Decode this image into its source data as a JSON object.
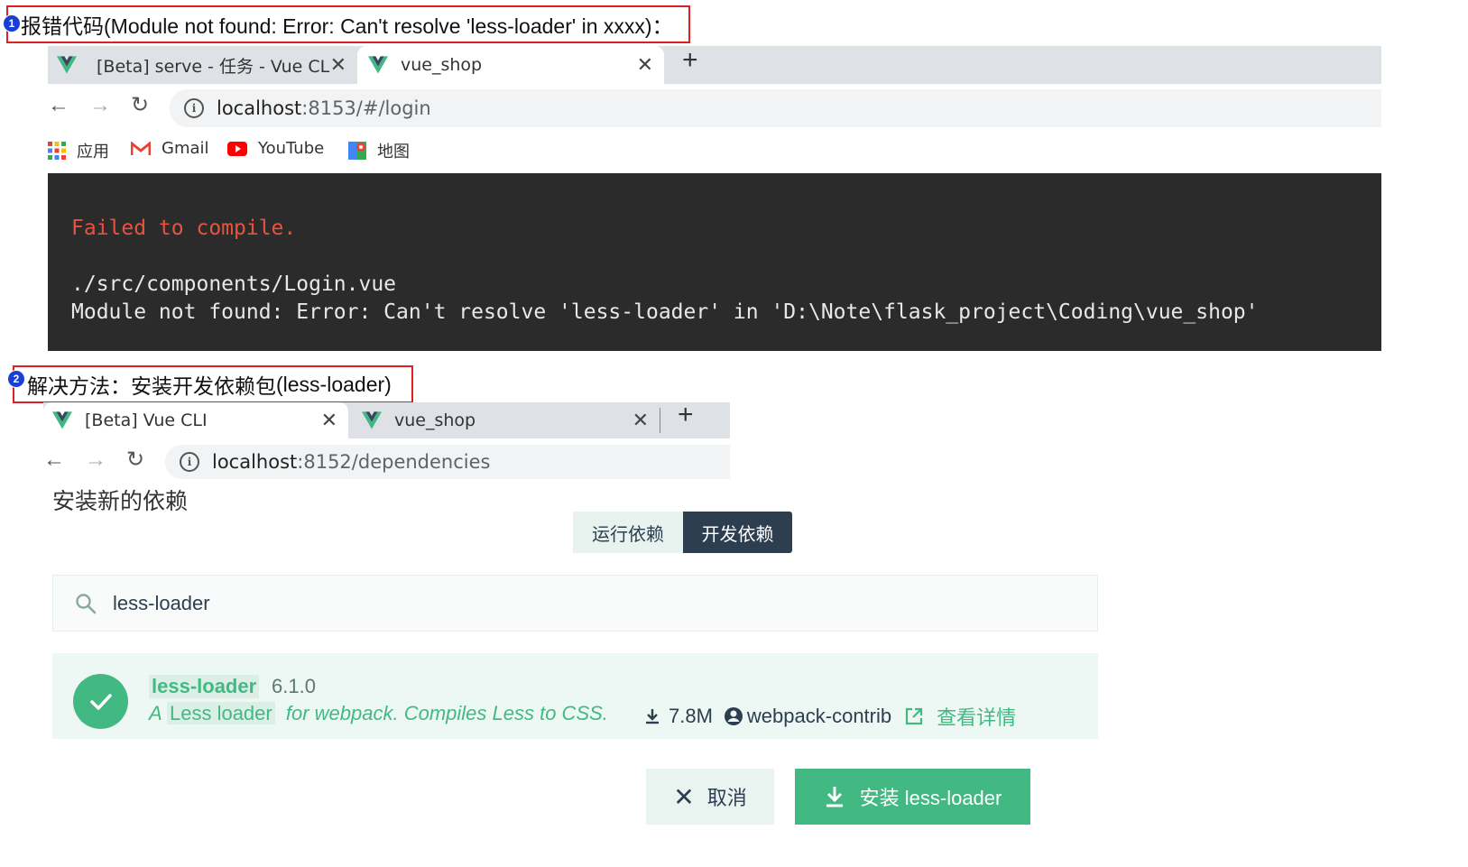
{
  "annotation1": {
    "number": "1",
    "label_cn": "报错代码",
    "label_en": "(Module not found: Error: Can't resolve 'less-loader' in xxxx)："
  },
  "annotation2": {
    "number": "2",
    "label_cn": "解决方法：安装开发依赖包",
    "label_en": "(less-loader)"
  },
  "browser1": {
    "tabs": [
      {
        "title": "[Beta] serve - 任务 - Vue CLI"
      },
      {
        "title": "vue_shop"
      }
    ],
    "new_tab": "+",
    "url_host": "localhost",
    "url_rest": ":8153/#/login",
    "bookmarks": [
      {
        "label": "应用",
        "icon": "apps-grid-icon"
      },
      {
        "label": "Gmail",
        "icon": "gmail-icon"
      },
      {
        "label": "YouTube",
        "icon": "youtube-icon"
      },
      {
        "label": "地图",
        "icon": "maps-icon"
      }
    ]
  },
  "terminal": {
    "error_title": "Failed to compile.",
    "file_path": "./src/components/Login.vue",
    "error_message": "Module not found: Error: Can't resolve 'less-loader' in 'D:\\Note\\flask_project\\Coding\\vue_shop'"
  },
  "browser2": {
    "tabs": [
      {
        "title": "[Beta] Vue CLI"
      },
      {
        "title": "vue_shop"
      }
    ],
    "new_tab": "+",
    "url_host": "localhost",
    "url_rest": ":8152/dependencies"
  },
  "install_panel": {
    "heading": "安装新的依赖",
    "segments": [
      {
        "label": "运行依赖",
        "selected": false
      },
      {
        "label": "开发依赖",
        "selected": true
      }
    ],
    "search_value": "less-loader",
    "result": {
      "name": "less-loader",
      "version": "6.1.0",
      "desc_prefix": "A",
      "desc_highlight": "Less loader",
      "desc_suffix": "for webpack. Compiles Less to CSS.",
      "downloads": "7.8M",
      "author": "webpack-contrib",
      "details_link": "查看详情"
    },
    "cancel_label": "取消",
    "install_label": "安装 less-loader"
  },
  "colors": {
    "vue_green": "#42b983",
    "terminal_bg": "#2b2b2b",
    "error_red": "#e8533f",
    "annot_red": "#e02020",
    "dark_seg": "#2c3e50"
  }
}
